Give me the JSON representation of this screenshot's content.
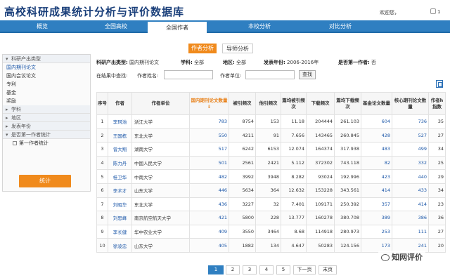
{
  "header": {
    "title": "高校科研成果统计分析与评价数据库",
    "welcome": "欢迎您，",
    "user": "1"
  },
  "nav": {
    "tabs": [
      "概览",
      "全国高校",
      "全国作者",
      "本校分析",
      "对比分析"
    ],
    "active_index": 2
  },
  "sidebar": {
    "groups": [
      {
        "label": "科研产出类型",
        "expanded": true,
        "items": [
          "国内期刊论文",
          "国内会议论文",
          "专利",
          "基金",
          "奖励"
        ],
        "selected": 0
      },
      {
        "label": "学科",
        "expanded": false
      },
      {
        "label": "地区",
        "expanded": false
      },
      {
        "label": "发表年份",
        "expanded": false
      },
      {
        "label": "是否第一作者统计",
        "expanded": true,
        "checkbox": "第一作者统计"
      }
    ],
    "stat_button": "统计"
  },
  "sub_tabs": {
    "active": "作者分析",
    "inactive": "导师分析"
  },
  "filters": {
    "type_label": "科研产出类型:",
    "type_value": "国内期刊论文",
    "subject_label": "学科:",
    "subject_value": "全部",
    "region_label": "地区:",
    "region_value": "全部",
    "year_label": "发表年份:",
    "year_value": "2006-2016年",
    "first_label": "是否第一作者:",
    "first_value": "否"
  },
  "search": {
    "scope_label": "在结果中查找:",
    "author_label": "作者姓名:",
    "unit_label": "作者单位:",
    "button": "查找"
  },
  "table": {
    "headers": [
      "序号",
      "作者",
      "作者单位",
      "国内期刊论文数量⇓",
      "被引频次",
      "他引频次",
      "篇均被引频次",
      "下载频次",
      "篇均下载频次",
      "基金论文数量",
      "核心期刊论文数量",
      "作者h指数"
    ],
    "rows": [
      [
        "1",
        "李珂池",
        "浙江大学",
        "783",
        "8754",
        "153",
        "11.18",
        "204444",
        "261.103",
        "604",
        "736",
        "35"
      ],
      [
        "2",
        "王国栋",
        "东北大学",
        "550",
        "4211",
        "91",
        "7.656",
        "143465",
        "260.845",
        "428",
        "527",
        "27"
      ],
      [
        "3",
        "曾大翔",
        "湖南大学",
        "517",
        "6242",
        "6153",
        "12.074",
        "164374",
        "317.938",
        "483",
        "499",
        "34"
      ],
      [
        "4",
        "陈力丹",
        "中国人民大学",
        "501",
        "2561",
        "2421",
        "5.112",
        "372302",
        "743.118",
        "82",
        "332",
        "25"
      ],
      [
        "5",
        "桂卫华",
        "中南大学",
        "482",
        "3992",
        "3948",
        "8.282",
        "93024",
        "192.996",
        "423",
        "440",
        "29"
      ],
      [
        "6",
        "李术才",
        "山东大学",
        "446",
        "5634",
        "364",
        "12.632",
        "153228",
        "343.561",
        "414",
        "433",
        "34"
      ],
      [
        "7",
        "刘昭华",
        "东北大学",
        "436",
        "3227",
        "32",
        "7.401",
        "109171",
        "250.392",
        "357",
        "414",
        "23"
      ],
      [
        "8",
        "刘思峰",
        "南京航空航天大学",
        "421",
        "5800",
        "228",
        "13.777",
        "160278",
        "380.708",
        "389",
        "386",
        "36"
      ],
      [
        "9",
        "李长健",
        "华中农业大学",
        "409",
        "3550",
        "3464",
        "8.68",
        "114918",
        "280.973",
        "253",
        "111",
        "27"
      ],
      [
        "10",
        "徐凌忠",
        "山东大学",
        "405",
        "1882",
        "134",
        "4.647",
        "50283",
        "124.156",
        "173",
        "241",
        "20"
      ]
    ]
  },
  "pager": {
    "pages": [
      "1",
      "2",
      "3",
      "4",
      "5"
    ],
    "next": "下一页",
    "last": "末页",
    "active": "1"
  },
  "watermark": "知网评价",
  "colors": {
    "nav_blue": "#2f7fc1",
    "accent_orange": "#f08a1c",
    "link_blue": "#1a56a8"
  }
}
